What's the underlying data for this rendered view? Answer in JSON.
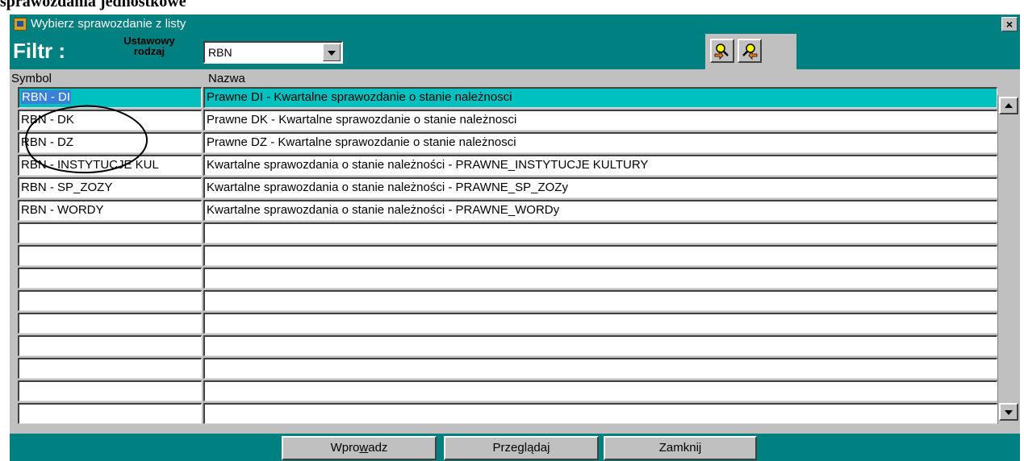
{
  "document": {
    "heading": "sprawozdania jednostkowe"
  },
  "window": {
    "title": "Wybierz sprawozdanie z listy",
    "close_label": "×"
  },
  "filter": {
    "label": "Filtr :",
    "sublabel_1": "Ustawowy",
    "sublabel_2": "rodzaj",
    "select_value": "RBN"
  },
  "tools": {
    "btn1": "search-forward-icon",
    "btn2": "search-back-icon"
  },
  "columns": {
    "symbol": "Symbol",
    "name": "Nazwa"
  },
  "rows": [
    {
      "symbol": "RBN - DI",
      "name": "Prawne DI - Kwartalne sprawozdanie o stanie należnosci"
    },
    {
      "symbol": "RBN - DK",
      "name": "Prawne DK - Kwartalne sprawozdanie o stanie należnosci"
    },
    {
      "symbol": "RBN - DZ",
      "name": "Prawne DZ - Kwartalne sprawozdanie o stanie należnosci"
    },
    {
      "symbol": "RBN - INSTYTUCJE KUL",
      "name": "Kwartalne sprawozdania o stanie należności - PRAWNE_INSTYTUCJE KULTURY"
    },
    {
      "symbol": "RBN - SP_ZOZY",
      "name": "Kwartalne sprawozdania o stanie należności - PRAWNE_SP_ZOZy"
    },
    {
      "symbol": "RBN - WORDY",
      "name": "Kwartalne sprawozdania o stanie należności - PRAWNE_WORDy"
    }
  ],
  "empty_rows": 9,
  "buttons": {
    "enter": "Wprowadz",
    "browse": "Przeglądaj",
    "close": "Zamknij"
  },
  "colors": {
    "title_bar": "#008080",
    "selected_row": "#00c0c0",
    "selected_cell": "#3a7fd8"
  }
}
